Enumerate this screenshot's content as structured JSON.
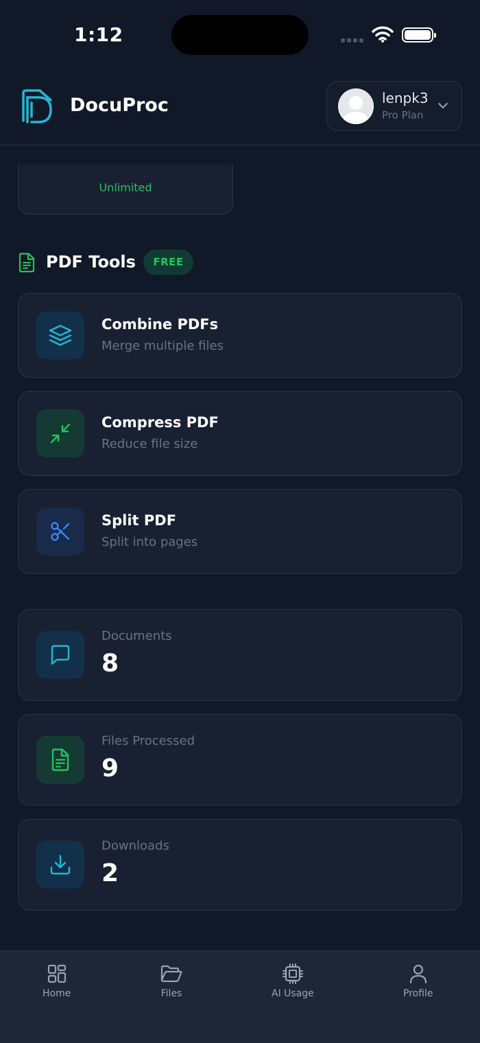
{
  "status_bar": {
    "time": "1:12"
  },
  "header": {
    "app_title": "DocuProc",
    "user": {
      "name": "lenpk3",
      "plan": "Pro Plan"
    }
  },
  "usage_card": {
    "text": "Unlimited"
  },
  "pdf_tools": {
    "title": "PDF Tools",
    "badge": "FREE",
    "tools": [
      {
        "title": "Combine PDFs",
        "subtitle": "Merge multiple files",
        "icon": "layers-icon"
      },
      {
        "title": "Compress PDF",
        "subtitle": "Reduce file size",
        "icon": "compress-icon"
      },
      {
        "title": "Split PDF",
        "subtitle": "Split into pages",
        "icon": "scissors-icon"
      }
    ]
  },
  "stats": [
    {
      "label": "Documents",
      "value": "8",
      "icon": "chat-icon"
    },
    {
      "label": "Files Processed",
      "value": "9",
      "icon": "document-icon"
    },
    {
      "label": "Downloads",
      "value": "2",
      "icon": "download-icon"
    }
  ],
  "bottom_nav": [
    {
      "label": "Home",
      "icon": "grid-icon"
    },
    {
      "label": "Files",
      "icon": "folder-icon"
    },
    {
      "label": "AI Usage",
      "icon": "chip-icon"
    },
    {
      "label": "Profile",
      "icon": "user-icon"
    }
  ],
  "colors": {
    "background": "#111827",
    "card": "#182032",
    "border": "#2b3446",
    "accent_cyan": "#22b8d4",
    "accent_green": "#22c55e",
    "accent_blue": "#3b82f6",
    "muted_text": "#6b7280"
  }
}
